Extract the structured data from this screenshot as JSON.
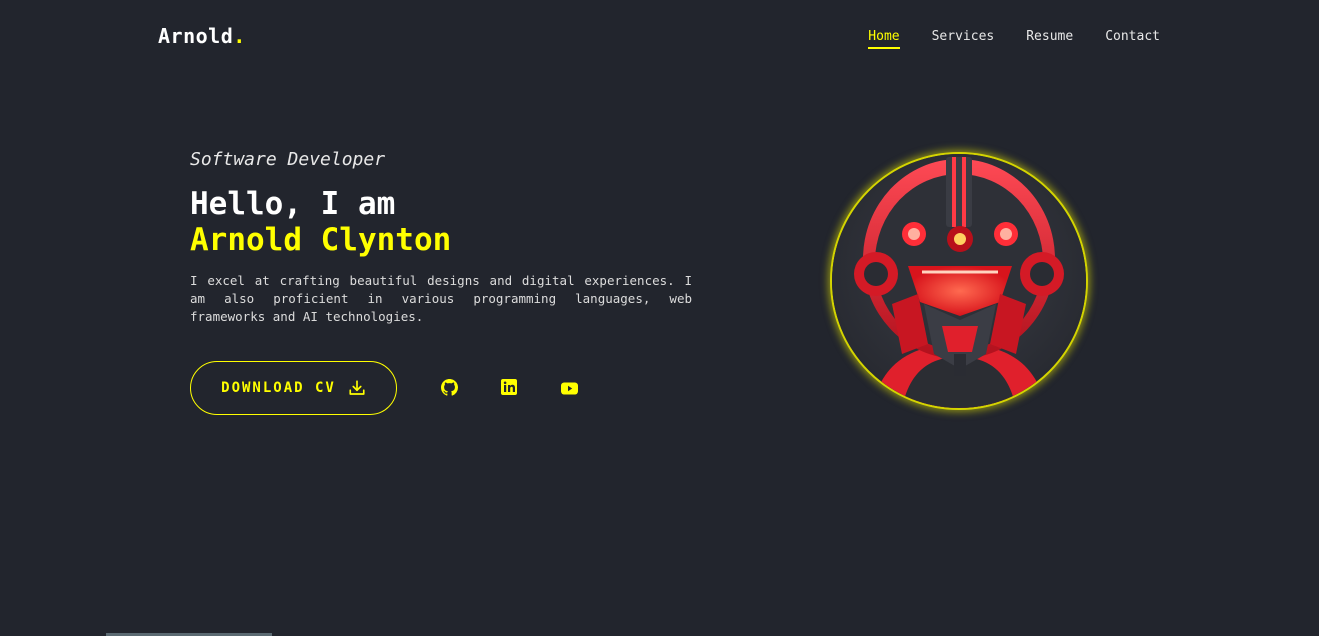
{
  "header": {
    "logo_text": "Arnold",
    "logo_dot": ".",
    "nav": [
      {
        "label": "Home",
        "active": true
      },
      {
        "label": "Services",
        "active": false
      },
      {
        "label": "Resume",
        "active": false
      },
      {
        "label": "Contact",
        "active": false
      }
    ]
  },
  "hero": {
    "role": "Software Developer",
    "greeting": "Hello, I am",
    "name": "Arnold Clynton",
    "bio": "I excel at crafting beautiful designs and digital experiences. I am also proficient in various programming languages, web frameworks and AI technologies.",
    "download_label": "DOWNLOAD CV",
    "download_icon": "download-icon",
    "social": [
      {
        "icon": "github-icon"
      },
      {
        "icon": "linkedin-icon"
      },
      {
        "icon": "youtube-icon"
      }
    ]
  },
  "colors": {
    "background": "#22252d",
    "accent": "#ffff00",
    "text": "#e8e8e8"
  },
  "portrait": {
    "subject": "red robot helmet avatar"
  }
}
